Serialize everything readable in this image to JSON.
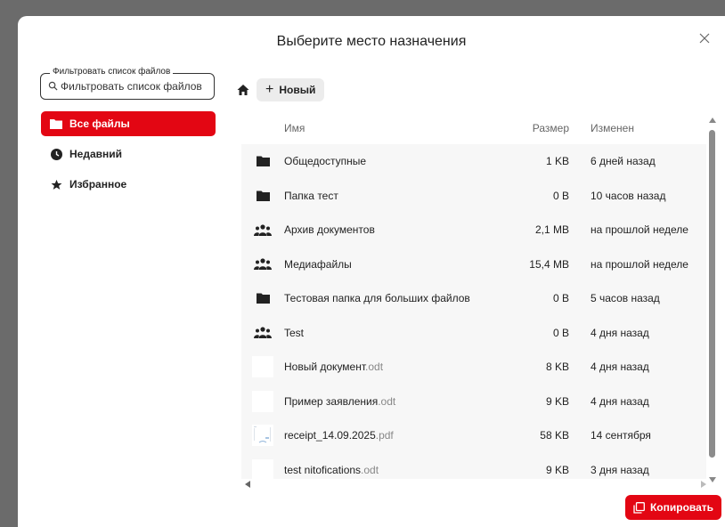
{
  "dialog": {
    "title": "Выберите место назначения"
  },
  "filter": {
    "legend": "Фильтровать список файлов",
    "placeholder": "Фильтровать список файлов",
    "value": ""
  },
  "nav": {
    "items": [
      {
        "label": "Все файлы",
        "icon": "folder-icon",
        "active": true
      },
      {
        "label": "Недавний",
        "icon": "clock-icon",
        "active": false
      },
      {
        "label": "Избранное",
        "icon": "star-icon",
        "active": false
      }
    ]
  },
  "toolbar": {
    "new_label": "Новый"
  },
  "table": {
    "headers": {
      "name": "Имя",
      "size": "Размер",
      "modified": "Изменен"
    },
    "rows": [
      {
        "icon": "folder-icon",
        "name": "Общедоступные",
        "ext": "",
        "size": "1 KB",
        "modified": "6 дней назад"
      },
      {
        "icon": "folder-icon",
        "name": "Папка тест",
        "ext": "",
        "size": "0 B",
        "modified": "10 часов назад"
      },
      {
        "icon": "shared-folder-icon",
        "name": "Архив документов",
        "ext": "",
        "size": "2,1 MB",
        "modified": "на прошлой неделе"
      },
      {
        "icon": "shared-folder-icon",
        "name": "Медиафайлы",
        "ext": "",
        "size": "15,4 MB",
        "modified": "на прошлой неделе"
      },
      {
        "icon": "folder-icon",
        "name": "Тестовая папка для больших файлов",
        "ext": "",
        "size": "0 B",
        "modified": "5 часов назад"
      },
      {
        "icon": "shared-folder-icon",
        "name": "Test",
        "ext": "",
        "size": "0 B",
        "modified": "4 дня назад"
      },
      {
        "icon": "document-thumbnail-icon",
        "name": "Новый документ",
        "ext": ".odt",
        "size": "8 KB",
        "modified": "4 дня назад"
      },
      {
        "icon": "document-thumbnail-icon",
        "name": "Пример заявления",
        "ext": ".odt",
        "size": "9 KB",
        "modified": "4 дня назад"
      },
      {
        "icon": "pdf-thumbnail-icon",
        "name": "receipt_14.09.2025",
        "ext": ".pdf",
        "size": "58 KB",
        "modified": "14 сентября"
      },
      {
        "icon": "document-thumbnail-icon",
        "name": "test nitofications",
        "ext": ".odt",
        "size": "9 KB",
        "modified": "3 дня назад"
      }
    ]
  },
  "actions": {
    "copy_label": "Копировать"
  },
  "colors": {
    "accent": "#e30613"
  }
}
